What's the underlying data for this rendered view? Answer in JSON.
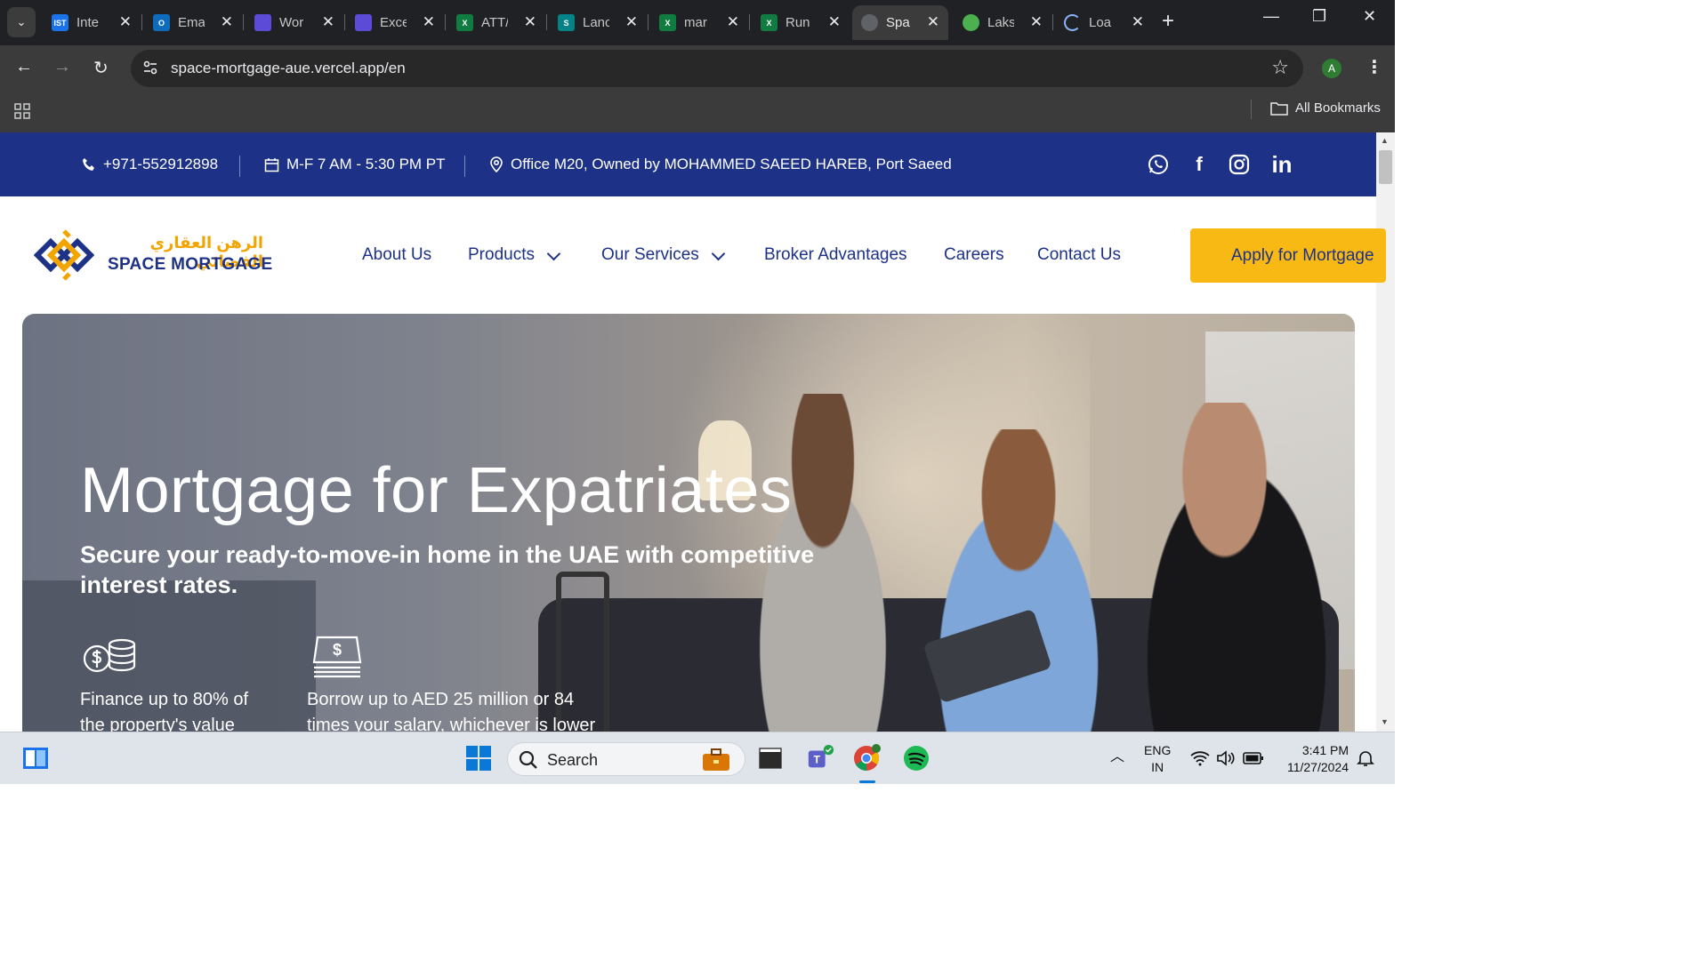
{
  "browser": {
    "tabs": [
      {
        "label": "Inte",
        "favicon": "ist-icon",
        "color": "#1a73e8",
        "glyph": "IST"
      },
      {
        "label": "Ema",
        "favicon": "outlook-icon",
        "color": "#0f6cbd",
        "glyph": "O"
      },
      {
        "label": "Wor",
        "favicon": "copilot-icon",
        "color": "#5b4bd6",
        "glyph": ""
      },
      {
        "label": "Exce",
        "favicon": "copilot-icon",
        "color": "#5b4bd6",
        "glyph": ""
      },
      {
        "label": "ATT/",
        "favicon": "excel-icon",
        "color": "#107c41",
        "glyph": "X"
      },
      {
        "label": "Lanc",
        "favicon": "sharepoint-icon",
        "color": "#038387",
        "glyph": "S"
      },
      {
        "label": "mar",
        "favicon": "excel-icon",
        "color": "#107c41",
        "glyph": "X"
      },
      {
        "label": "Run",
        "favicon": "excel-icon",
        "color": "#107c41",
        "glyph": "X"
      },
      {
        "label": "Spa",
        "favicon": "globe-icon",
        "color": "#5f6368",
        "glyph": ""
      },
      {
        "label": "Laks",
        "favicon": "clover-icon",
        "color": "#4caf50",
        "glyph": ""
      },
      {
        "label": "Loa",
        "favicon": "loading-spinner-icon",
        "color": "#8ab4f8",
        "glyph": ""
      }
    ],
    "active_tab_index": 8,
    "url": "space-mortgage-aue.vercel.app/en",
    "profile_initial": "A",
    "bookmarks_label": "All Bookmarks"
  },
  "topbar": {
    "phone": "+971-552912898",
    "hours": "M-F 7 AM - 5:30 PM PT",
    "address": "Office M20, Owned by MOHAMMED SAEED HAREB, Port Saeed",
    "social_icons": [
      "whatsapp-icon",
      "facebook-icon",
      "instagram-icon",
      "linkedin-icon"
    ]
  },
  "nav": {
    "logo_arabic": "الرهن العقاري الفضائي",
    "logo_english": "SPACE MORTGAGE",
    "links": [
      "About Us",
      "Products",
      "Our Services",
      "Broker Advantages",
      "Careers",
      "Contact Us"
    ],
    "cta": "Apply for Mortgage",
    "brand_blue": "#1d3287",
    "brand_yellow": "#f9b914"
  },
  "hero": {
    "title": "Mortgage for Expatriates",
    "subtitle": "Secure your ready-to-move-in home in the UAE with competitive interest rates.",
    "features": [
      {
        "icon": "coins-icon",
        "text": "Finance up to 80% of the property's value"
      },
      {
        "icon": "cash-icon",
        "text": "Borrow up to AED 25 million or 84 times your salary, whichever is lower"
      }
    ]
  },
  "taskbar": {
    "search_placeholder": "Search",
    "language": "ENG",
    "region": "IN",
    "time": "3:41 PM",
    "date": "11/27/2024"
  }
}
